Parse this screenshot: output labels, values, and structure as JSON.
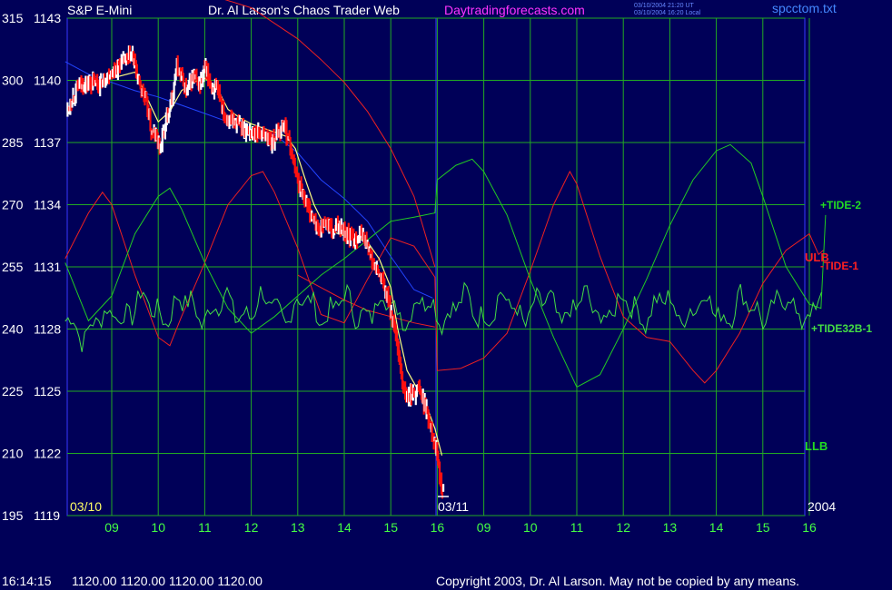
{
  "header": {
    "instrument": "S&P E-Mini",
    "title": "Dr. Al Larson's Chaos Trader Web",
    "site": "Daytradingforecasts.com",
    "stamp_line1": "03/10/2004 21:20 UT",
    "stamp_line2": "03/10/2004 16:20 Local",
    "filename": "spcctom.txt"
  },
  "footer": {
    "time": "16:14:15",
    "quote": "1120.00 1120.00 1120.00 1120.00",
    "copyright": "Copyright 2003, Dr. Al Larson. May not be copied by any means."
  },
  "colors": {
    "background": "#000058",
    "plot_border": "#3838ff",
    "grid": "#22aa22",
    "price_up": "#ffffff",
    "price_down": "#ff1010",
    "axis_text": "#ffffff",
    "time_labels": "#44ff44",
    "tide2": "#22cc22",
    "tide1": "#ee2020",
    "tide32": "#44dd44",
    "ma": "#ffff80",
    "blue_line": "#2244ff",
    "site": "#ff33ff",
    "filename": "#4488ff"
  },
  "chart_data": {
    "type": "line",
    "title": "S&P E-Mini",
    "y_left_labels": [
      "315",
      "300",
      "285",
      "270",
      "255",
      "240",
      "225",
      "210",
      "195"
    ],
    "y_right_labels": [
      "1143",
      "1140",
      "1137",
      "1134",
      "1131",
      "1128",
      "1125",
      "1122",
      "1119"
    ],
    "ylim": [
      1119,
      1143
    ],
    "x_hours": [
      "09",
      "10",
      "11",
      "12",
      "13",
      "14",
      "15",
      "16",
      "09",
      "10",
      "11",
      "12",
      "13",
      "14",
      "15",
      "16"
    ],
    "date_left": "03/10",
    "date_split": "03/11",
    "year": "2004",
    "series_labels": {
      "tide2": "+TIDE-2",
      "ulb": "ULB",
      "tide1": "-TIDE-1",
      "tide32": "+TIDE32B-1",
      "llb": "LLB"
    },
    "price_path": [
      [
        8.05,
        1138.6
      ],
      [
        8.25,
        1139.6
      ],
      [
        8.5,
        1139.9
      ],
      [
        8.75,
        1139.8
      ],
      [
        9.0,
        1140.4
      ],
      [
        9.25,
        1140.9
      ],
      [
        9.45,
        1141.2
      ],
      [
        9.6,
        1139.8
      ],
      [
        9.75,
        1138.9
      ],
      [
        9.85,
        1137.5
      ],
      [
        9.95,
        1137.3
      ],
      [
        10.05,
        1136.8
      ],
      [
        10.15,
        1137.8
      ],
      [
        10.3,
        1139.3
      ],
      [
        10.4,
        1140.6
      ],
      [
        10.5,
        1140.2
      ],
      [
        10.6,
        1139.4
      ],
      [
        10.75,
        1140.2
      ],
      [
        10.9,
        1139.7
      ],
      [
        11.0,
        1140.6
      ],
      [
        11.15,
        1139.7
      ],
      [
        11.3,
        1139.4
      ],
      [
        11.45,
        1138.2
      ],
      [
        11.65,
        1138.0
      ],
      [
        11.85,
        1137.6
      ],
      [
        12.05,
        1137.5
      ],
      [
        12.25,
        1137.4
      ],
      [
        12.45,
        1137.0
      ],
      [
        12.7,
        1137.9
      ],
      [
        12.8,
        1137.2
      ],
      [
        12.9,
        1136.2
      ],
      [
        13.0,
        1135.2
      ],
      [
        13.15,
        1134.3
      ],
      [
        13.3,
        1133.5
      ],
      [
        13.45,
        1132.7
      ],
      [
        13.6,
        1133.2
      ],
      [
        13.75,
        1132.6
      ],
      [
        13.9,
        1133.1
      ],
      [
        14.05,
        1132.6
      ],
      [
        14.2,
        1132.3
      ],
      [
        14.35,
        1132.6
      ],
      [
        14.5,
        1132.1
      ],
      [
        14.6,
        1131.2
      ],
      [
        14.8,
        1130.4
      ],
      [
        14.95,
        1129.4
      ],
      [
        15.05,
        1128.4
      ],
      [
        15.25,
        1125.4
      ],
      [
        15.35,
        1124.6
      ],
      [
        15.5,
        1124.9
      ],
      [
        15.6,
        1125.3
      ],
      [
        15.75,
        1124.2
      ],
      [
        15.85,
        1123.4
      ],
      [
        16.0,
        1122.0
      ],
      [
        16.05,
        1121.1
      ],
      [
        16.15,
        1120.0
      ]
    ],
    "ma_path": [
      [
        8.4,
        1139.6
      ],
      [
        9.0,
        1140.1
      ],
      [
        9.5,
        1140.4
      ],
      [
        9.75,
        1139.2
      ],
      [
        10.0,
        1138.0
      ],
      [
        10.25,
        1138.5
      ],
      [
        10.5,
        1139.5
      ],
      [
        10.75,
        1139.9
      ],
      [
        11.0,
        1140.1
      ],
      [
        11.25,
        1139.7
      ],
      [
        11.5,
        1138.6
      ],
      [
        11.75,
        1138.2
      ],
      [
        12.0,
        1137.9
      ],
      [
        12.25,
        1137.7
      ],
      [
        12.5,
        1137.5
      ],
      [
        12.75,
        1137.3
      ],
      [
        12.95,
        1136.7
      ],
      [
        13.15,
        1135.3
      ],
      [
        13.35,
        1134.0
      ],
      [
        13.55,
        1133.1
      ],
      [
        13.75,
        1132.7
      ],
      [
        14.0,
        1132.5
      ],
      [
        14.25,
        1132.4
      ],
      [
        14.5,
        1132.2
      ],
      [
        14.75,
        1131.4
      ],
      [
        15.0,
        1130.0
      ],
      [
        15.15,
        1128.0
      ],
      [
        15.35,
        1126.0
      ],
      [
        15.55,
        1125.2
      ],
      [
        15.75,
        1124.4
      ],
      [
        15.95,
        1123.2
      ],
      [
        16.1,
        1121.9
      ]
    ],
    "blue_path": [
      [
        8.0,
        1140.9
      ],
      [
        8.5,
        1140.3
      ],
      [
        9.0,
        1139.9
      ],
      [
        9.5,
        1139.5
      ],
      [
        10.0,
        1139.2
      ],
      [
        10.5,
        1138.8
      ],
      [
        11.0,
        1138.4
      ],
      [
        11.5,
        1138.0
      ],
      [
        12.0,
        1137.7
      ],
      [
        12.5,
        1137.4
      ],
      [
        13.0,
        1136.5
      ],
      [
        13.5,
        1135.2
      ],
      [
        14.0,
        1134.3
      ],
      [
        14.5,
        1133.2
      ],
      [
        15.0,
        1131.5
      ],
      [
        15.5,
        1129.9
      ],
      [
        15.9,
        1129.5
      ]
    ],
    "tide2_path": [
      [
        8.0,
        1131.2
      ],
      [
        8.5,
        1128.4
      ],
      [
        9.0,
        1129.6
      ],
      [
        9.5,
        1132.6
      ],
      [
        10.0,
        1134.4
      ],
      [
        10.25,
        1134.8
      ],
      [
        10.5,
        1133.8
      ],
      [
        11.0,
        1131.2
      ],
      [
        11.5,
        1129.0
      ],
      [
        12.0,
        1127.8
      ],
      [
        12.5,
        1128.6
      ],
      [
        13.0,
        1129.6
      ],
      [
        13.5,
        1130.6
      ],
      [
        14.0,
        1131.4
      ],
      [
        14.5,
        1132.3
      ],
      [
        15.0,
        1133.2
      ],
      [
        15.5,
        1133.4
      ],
      [
        15.95,
        1133.6
      ],
      [
        16.0,
        1135.2
      ],
      [
        16.4,
        1135.9
      ],
      [
        16.75,
        1136.2
      ],
      [
        17.0,
        1135.6
      ],
      [
        17.5,
        1133.5
      ],
      [
        18.0,
        1130.4
      ],
      [
        18.5,
        1127.6
      ],
      [
        19.0,
        1125.2
      ],
      [
        19.5,
        1125.8
      ],
      [
        20.0,
        1128.0
      ],
      [
        20.5,
        1130.4
      ],
      [
        21.0,
        1133.0
      ],
      [
        21.5,
        1135.2
      ],
      [
        22.0,
        1136.6
      ],
      [
        22.3,
        1136.9
      ],
      [
        22.75,
        1136.0
      ],
      [
        23.0,
        1134.4
      ],
      [
        23.5,
        1131.0
      ],
      [
        24.0,
        1129.2
      ],
      [
        24.25,
        1129.0
      ],
      [
        24.35,
        1133.5
      ]
    ],
    "tide1_path": [
      [
        8.0,
        1131.4
      ],
      [
        8.5,
        1133.6
      ],
      [
        8.8,
        1134.6
      ],
      [
        9.0,
        1134.0
      ],
      [
        9.5,
        1130.6
      ],
      [
        10.0,
        1127.6
      ],
      [
        10.25,
        1127.2
      ],
      [
        10.5,
        1128.6
      ],
      [
        11.0,
        1131.2
      ],
      [
        11.5,
        1134.0
      ],
      [
        12.0,
        1135.4
      ],
      [
        12.25,
        1135.6
      ],
      [
        12.5,
        1134.6
      ],
      [
        13.0,
        1131.9
      ],
      [
        13.5,
        1128.7
      ],
      [
        14.0,
        1128.3
      ],
      [
        14.5,
        1130.4
      ],
      [
        15.0,
        1132.4
      ],
      [
        15.5,
        1132.0
      ],
      [
        15.95,
        1130.5
      ],
      [
        16.0,
        1126.0
      ],
      [
        16.5,
        1126.1
      ],
      [
        17.0,
        1126.6
      ],
      [
        17.5,
        1127.8
      ],
      [
        18.0,
        1130.8
      ],
      [
        18.5,
        1134.0
      ],
      [
        18.85,
        1135.6
      ],
      [
        19.0,
        1135.0
      ],
      [
        19.5,
        1131.5
      ],
      [
        20.0,
        1128.6
      ],
      [
        20.5,
        1127.6
      ],
      [
        21.0,
        1127.4
      ],
      [
        21.5,
        1126.0
      ],
      [
        21.75,
        1125.4
      ],
      [
        22.0,
        1126.0
      ],
      [
        22.5,
        1127.8
      ],
      [
        23.0,
        1130.2
      ],
      [
        23.5,
        1131.8
      ],
      [
        24.0,
        1132.6
      ],
      [
        24.2,
        1131.6
      ],
      [
        24.3,
        1131.8
      ]
    ],
    "red_upper_path": [
      [
        8.0,
        1143.9
      ],
      [
        9.0,
        1144.4
      ],
      [
        10.0,
        1144.5
      ],
      [
        11.0,
        1144.2
      ],
      [
        12.0,
        1143.5
      ],
      [
        13.0,
        1142.0
      ],
      [
        13.5,
        1141.0
      ],
      [
        14.0,
        1139.9
      ],
      [
        14.5,
        1138.5
      ],
      [
        15.0,
        1136.7
      ],
      [
        15.5,
        1134.4
      ],
      [
        15.95,
        1131.0
      ]
    ],
    "red_lower_path": [
      [
        13.0,
        1130.6
      ],
      [
        13.5,
        1130.0
      ],
      [
        14.0,
        1129.4
      ],
      [
        14.5,
        1128.9
      ],
      [
        15.0,
        1128.6
      ],
      [
        15.5,
        1128.3
      ],
      [
        15.95,
        1128.1
      ]
    ],
    "tide32_seed": 7,
    "tide32_base": 1129.0
  }
}
